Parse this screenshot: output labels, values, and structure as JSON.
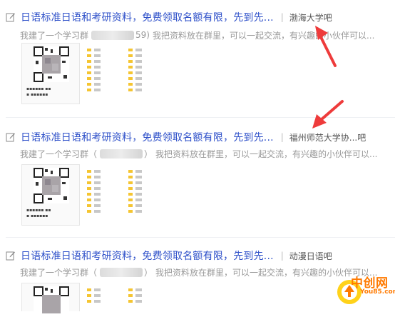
{
  "colors": {
    "link": "#2e50c9",
    "muted": "#999999",
    "forum": "#555555",
    "accent_red": "#ee3b3b",
    "logo_orange": "#ff7a00"
  },
  "posts": [
    {
      "title": "日语标准日语和考研资料，免费领取名额有限，先到先...",
      "separator": "|",
      "forum": "渤海大学吧",
      "excerpt_start": "我建了一个学习群",
      "excerpt_mid": "59)",
      "excerpt_end": "我把资料放在群里，可以一起交流，有兴趣的小伙伴可以...",
      "icon": "edit-icon"
    },
    {
      "title": "日语标准日语和考研资料，免费领取名额有限，先到先...",
      "separator": "|",
      "forum": "福州师范大学协...吧",
      "excerpt_start": "我建了一个学习群（",
      "excerpt_mid": "）",
      "excerpt_end": "我把资料放在群里，可以一起交流，有兴趣的小伙伴可以...",
      "icon": "edit-icon"
    },
    {
      "title": "日语标准日语和考研资料，免费领取名额有限，先到先...",
      "separator": "|",
      "forum": "动漫日语吧",
      "excerpt_start": "我建了一个学习群（",
      "excerpt_mid": "）",
      "excerpt_end": "我把资料放在群里，可以一起交流，有兴趣的小伙伴可以...",
      "icon": "edit-icon"
    }
  ],
  "watermark": {
    "name": "中创网",
    "domain": "You85.com"
  }
}
